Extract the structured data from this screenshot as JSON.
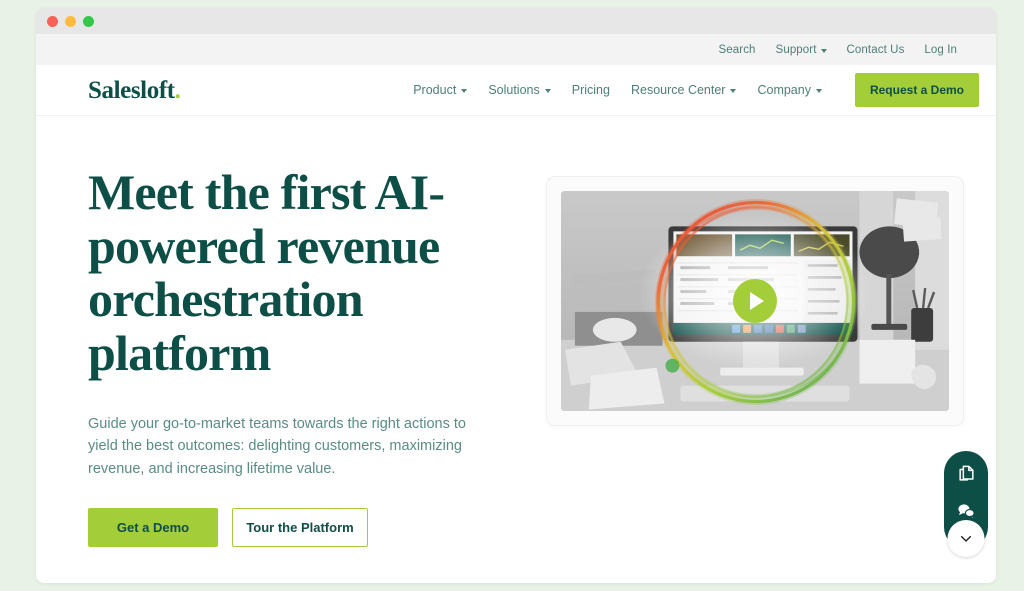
{
  "window": {
    "traffic_lights": [
      "close",
      "minimize",
      "maximize"
    ]
  },
  "utility_bar": {
    "links": [
      {
        "label": "Search",
        "icon": "search-link",
        "has_caret": false
      },
      {
        "label": "Support",
        "icon": "support-link",
        "has_caret": true
      },
      {
        "label": "Contact Us",
        "icon": "contact-link",
        "has_caret": false
      },
      {
        "label": "Log In",
        "icon": "login-link",
        "has_caret": false
      }
    ]
  },
  "header": {
    "logo_text": "Salesloft",
    "logo_dot": ".",
    "nav": [
      {
        "label": "Product",
        "has_caret": true
      },
      {
        "label": "Solutions",
        "has_caret": true
      },
      {
        "label": "Pricing",
        "has_caret": false
      },
      {
        "label": "Resource Center",
        "has_caret": true
      },
      {
        "label": "Company",
        "has_caret": true
      }
    ],
    "cta_label": "Request a Demo"
  },
  "hero": {
    "title": "Meet the first AI-powered revenue orchestration platform",
    "subtitle": "Guide your go-to-market teams towards the right actions to yield the best outcomes: delighting customers, maximizing revenue, and increasing lifetime value.",
    "primary_cta": "Get a Demo",
    "secondary_cta": "Tour the Platform",
    "video": {
      "alt": "Desk with computer monitor showing Salesloft dashboard",
      "play_icon": "play-icon"
    }
  },
  "fab_dock": {
    "items": [
      {
        "icon": "documents-icon",
        "label": "Resources"
      },
      {
        "icon": "chat-bubbles-icon",
        "label": "Chat"
      }
    ],
    "toggle_icon": "chevron-down-icon"
  },
  "colors": {
    "page_background": "#e9f2e7",
    "brand_dark_teal": "#0d4f47",
    "brand_green": "#a4ce39",
    "muted_teal": "#4e7f77",
    "chrome_gray": "#e7e7e7",
    "utility_gray": "#f3f3f3"
  }
}
